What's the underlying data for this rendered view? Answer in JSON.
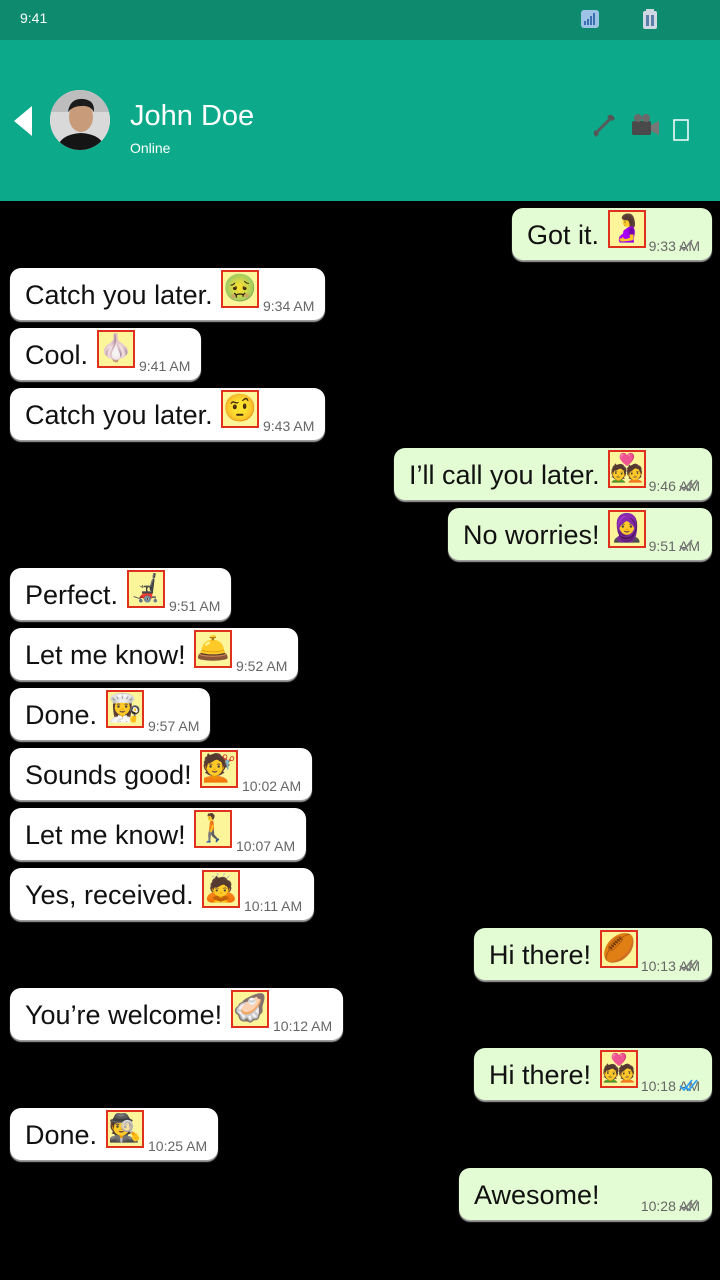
{
  "status_bar": {
    "time": "9:41"
  },
  "header": {
    "contact_name": "John Doe",
    "presence": "Online",
    "icons": [
      "back-arrow-icon",
      "phone-icon",
      "video-camera-icon",
      "menu-icon"
    ],
    "background": "#0ca98a"
  },
  "colors": {
    "incoming": "#ffffff",
    "outgoing": "#e4fcd3",
    "read_tick": "#2a9df4",
    "emoji_border": "#e0301e"
  },
  "messages": [
    {
      "direction": "out",
      "text": "Got it.",
      "emoji": "🤰",
      "time": "9:33 AM",
      "status": "sent"
    },
    {
      "direction": "in",
      "text": "Catch you later.",
      "emoji": "🤢",
      "time": "9:34 AM"
    },
    {
      "direction": "in",
      "text": "Cool.",
      "emoji": "🧄",
      "time": "9:41 AM"
    },
    {
      "direction": "in",
      "text": "Catch you later.",
      "emoji": "🤨",
      "time": "9:43 AM"
    },
    {
      "direction": "out",
      "text": "I’ll call you later.",
      "emoji": "💑",
      "time": "9:46 AM",
      "status": "delivered"
    },
    {
      "direction": "out",
      "text": "No worries!",
      "emoji": "🧕",
      "time": "9:51 AM",
      "status": "sent"
    },
    {
      "direction": "in",
      "text": "Perfect.",
      "emoji": "🦼",
      "time": "9:51 AM"
    },
    {
      "direction": "in",
      "text": "Let me know!",
      "emoji": "🛎️",
      "time": "9:52 AM"
    },
    {
      "direction": "in",
      "text": "Done.",
      "emoji": "👩‍🍳",
      "time": "9:57 AM"
    },
    {
      "direction": "in",
      "text": "Sounds good!",
      "emoji": "💇",
      "time": "10:02 AM"
    },
    {
      "direction": "in",
      "text": "Let me know!",
      "emoji": "🚶",
      "time": "10:07 AM"
    },
    {
      "direction": "in",
      "text": "Yes, received.",
      "emoji": "🙇",
      "time": "10:11 AM"
    },
    {
      "direction": "out",
      "text": "Hi there!",
      "emoji": "🏉",
      "time": "10:13 AM",
      "status": "delivered"
    },
    {
      "direction": "in",
      "text": "You’re welcome!",
      "emoji": "🦪",
      "time": "10:12 AM"
    },
    {
      "direction": "out",
      "text": "Hi there!",
      "emoji": "💑",
      "time": "10:18 AM",
      "status": "read"
    },
    {
      "direction": "in",
      "text": "Done.",
      "emoji": "🕵️",
      "time": "10:25 AM"
    },
    {
      "direction": "out",
      "text": "Awesome!",
      "emoji": "",
      "time": "10:28 AM",
      "status": "delivered"
    }
  ]
}
